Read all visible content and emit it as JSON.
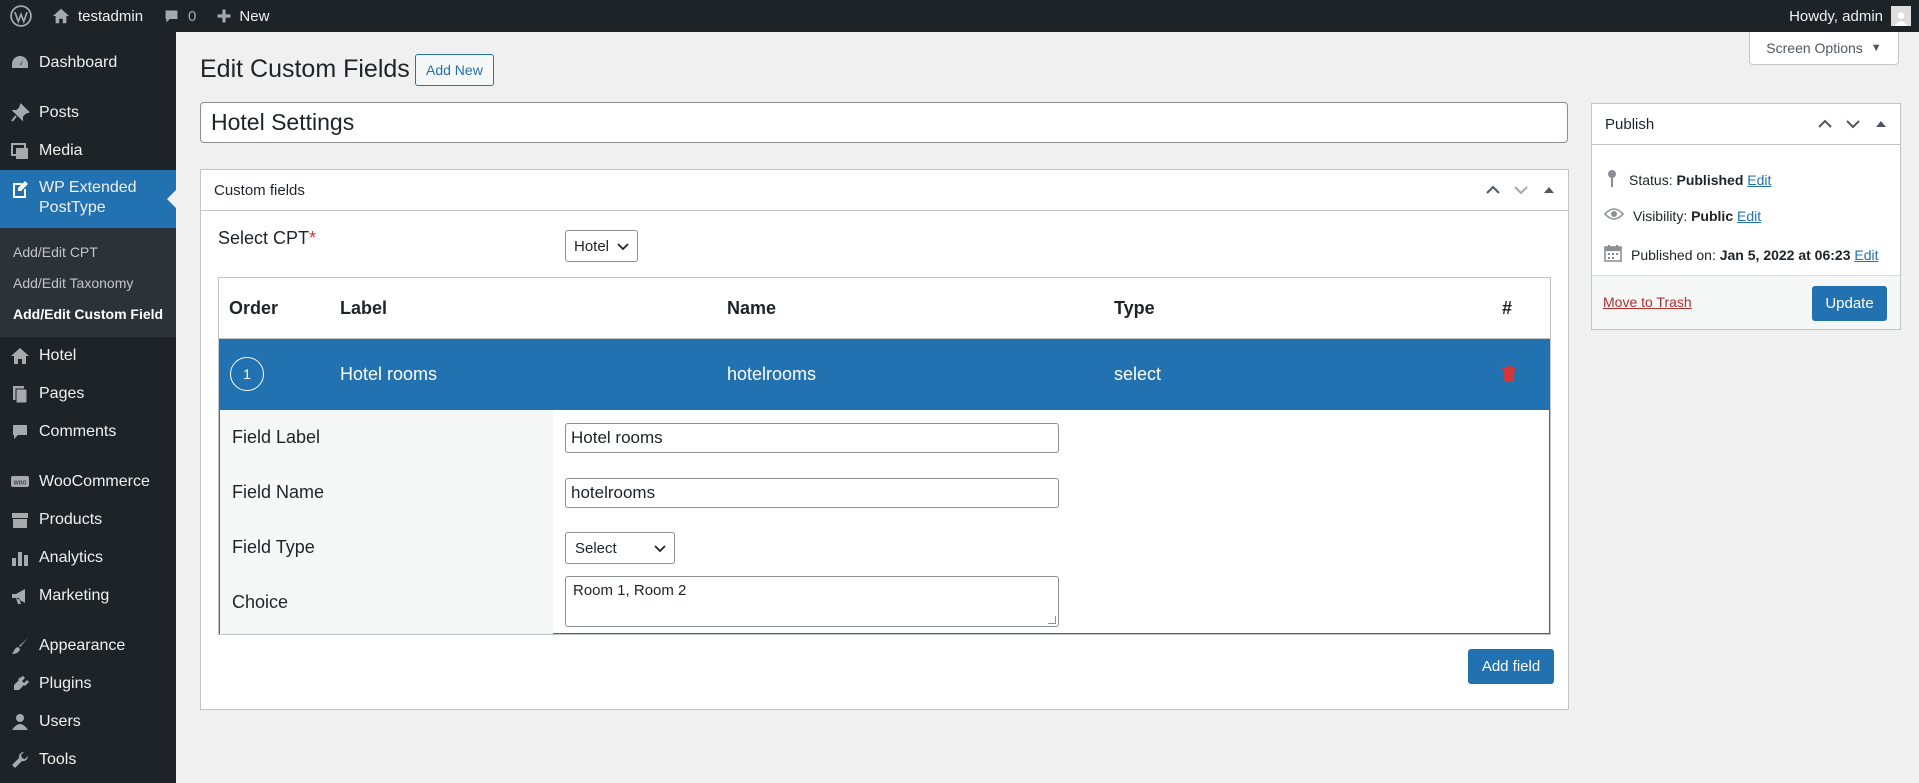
{
  "adminbar": {
    "site_name": "testadmin",
    "comments_count": "0",
    "new_label": "New",
    "howdy": "Howdy, admin"
  },
  "sidebar": {
    "items": [
      {
        "label": "Dashboard",
        "icon": "dashboard-icon"
      },
      {
        "label": "Posts",
        "icon": "pin-icon"
      },
      {
        "label": "Media",
        "icon": "media-icon"
      },
      {
        "label": "WP Extended PostType",
        "icon": "edit-page-icon"
      },
      {
        "label": "Hotel",
        "icon": "home-icon"
      },
      {
        "label": "Pages",
        "icon": "pages-icon"
      },
      {
        "label": "Comments",
        "icon": "comment-icon"
      },
      {
        "label": "WooCommerce",
        "icon": "woo-icon"
      },
      {
        "label": "Products",
        "icon": "archive-icon"
      },
      {
        "label": "Analytics",
        "icon": "chart-bar-icon"
      },
      {
        "label": "Marketing",
        "icon": "megaphone-icon"
      },
      {
        "label": "Appearance",
        "icon": "brush-icon"
      },
      {
        "label": "Plugins",
        "icon": "plug-icon"
      },
      {
        "label": "Users",
        "icon": "user-icon"
      },
      {
        "label": "Tools",
        "icon": "wrench-icon"
      }
    ],
    "current_label_line1": "WP Extended",
    "current_label_line2": "PostType",
    "submenu": [
      "Add/Edit CPT",
      "Add/Edit Taxonomy",
      "Add/Edit Custom Field"
    ]
  },
  "screen_options": "Screen Options",
  "page": {
    "title": "Edit Custom Fields",
    "add_new": "Add New",
    "post_title": "Hotel Settings"
  },
  "custom_fields": {
    "box_title": "Custom fields",
    "select_cpt_label": "Select CPT",
    "required_mark": "*",
    "select_cpt_value": "Hotel",
    "columns": {
      "order": "Order",
      "label": "Label",
      "name": "Name",
      "type": "Type",
      "action": "#"
    },
    "rows": [
      {
        "order": "1",
        "label": "Hotel rooms",
        "name": "hotelrooms",
        "type": "select"
      }
    ],
    "detail": {
      "field_label_label": "Field Label",
      "field_label_value": "Hotel rooms",
      "field_name_label": "Field Name",
      "field_name_value": "hotelrooms",
      "field_type_label": "Field Type",
      "field_type_value": "Select",
      "choice_label": "Choice",
      "choice_value": "Room 1, Room 2"
    },
    "add_field": "Add field"
  },
  "publish": {
    "title": "Publish",
    "status_label": "Status:",
    "status_value": "Published",
    "visibility_label": "Visibility:",
    "visibility_value": "Public",
    "published_label": "Published on:",
    "published_value": "Jan 5, 2022 at 06:23",
    "edit": "Edit",
    "move_to_trash": "Move to Trash",
    "update": "Update"
  },
  "colors": {
    "accent": "#2271b1",
    "admin_dark": "#1d2327",
    "danger": "#d63638"
  }
}
